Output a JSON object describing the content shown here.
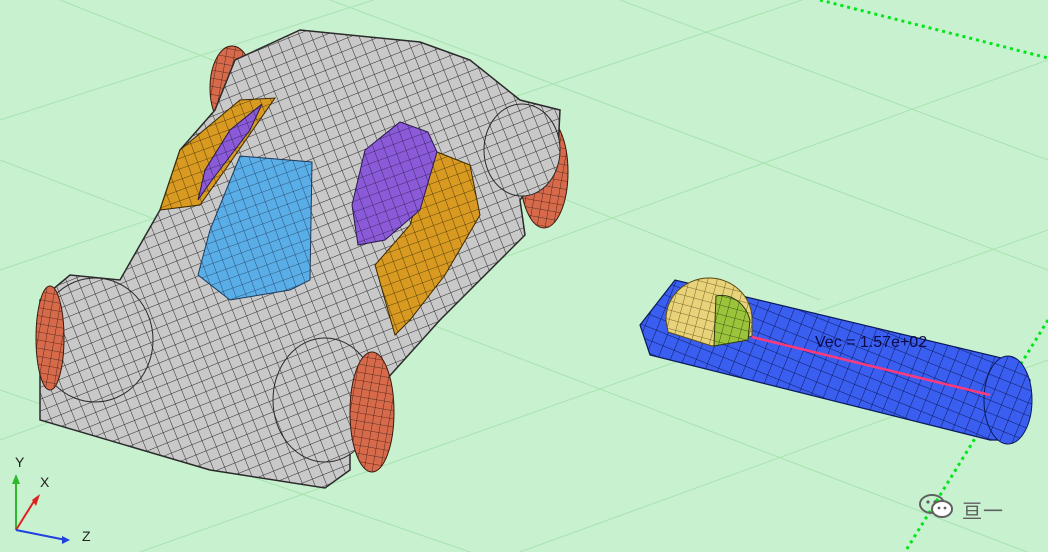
{
  "viewport": {
    "background": "#c8f2cf",
    "grid_color": "#a8e2b0",
    "boundary_color": "#00e61a"
  },
  "car_model": {
    "body_color": "#c9c9c9",
    "mesh_color": "#2a2a2a",
    "windshield_color": "#5aaee8",
    "side_glass_color": "#8a5ad8",
    "door_color": "#d99a22",
    "wheel_color": "#d66a4a"
  },
  "impactor_model": {
    "tube_color": "#3a5ef0",
    "ball_color": "#e8d27a",
    "ball_cap_color": "#9cc43a",
    "vector_color": "#ff3a7a",
    "vector_label": "Vec = 1.57e+02"
  },
  "triad": {
    "y_label": "Y",
    "x_label": "X",
    "z_label": "Z"
  },
  "watermark": {
    "text": "亘一",
    "icon": "wechat-icon"
  }
}
